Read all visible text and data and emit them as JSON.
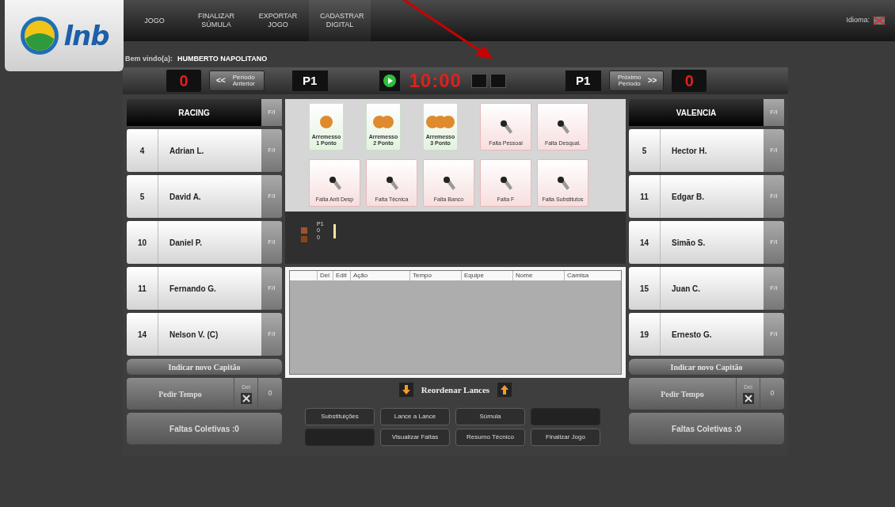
{
  "menu": [
    {
      "label": "JOGO",
      "selected": false
    },
    {
      "label": "FINALIZAR SÚMULA",
      "selected": false
    },
    {
      "label": "EXPORTAR JOGO",
      "selected": false
    },
    {
      "label": "CADASTRAR DIGITAL",
      "selected": true
    }
  ],
  "logo": {
    "text": "lnb"
  },
  "language": {
    "label": "Idioma:"
  },
  "welcome": {
    "label": "Bem vindo(a):",
    "user": "HUMBERTO NAPOLITANO"
  },
  "scoreboard": {
    "home_score": "0",
    "prev_button": {
      "arrow": "<<",
      "label": "Período Anterior"
    },
    "period_left": "P1",
    "clock": "10:00",
    "period_right": "P1",
    "next_button": {
      "arrow": ">>",
      "label": "Próximo Período"
    },
    "away_score": "0"
  },
  "teams": [
    {
      "name": "RACING",
      "tag": "F/I",
      "players": [
        {
          "number": "4",
          "name": "Adrian L.",
          "tag": "F/I"
        },
        {
          "number": "5",
          "name": "David A.",
          "tag": "F/I"
        },
        {
          "number": "10",
          "name": "Daniel P.",
          "tag": "F/I"
        },
        {
          "number": "11",
          "name": "Fernando G.",
          "tag": "F/I"
        },
        {
          "number": "14",
          "name": "Nelson V. (C)",
          "tag": "F/I"
        }
      ],
      "captain_button": "Indicar novo Capitão",
      "timeout_button": "Pedir Tempo",
      "delete_label": "Del",
      "timeouts": "0",
      "team_fouls": "Faltas Coletivas :0"
    },
    {
      "name": "VALENCIA",
      "tag": "F/I",
      "players": [
        {
          "number": "5",
          "name": "Hector H.",
          "tag": "F/I"
        },
        {
          "number": "11",
          "name": "Edgar B.",
          "tag": "F/I"
        },
        {
          "number": "14",
          "name": "Simão S.",
          "tag": "F/I"
        },
        {
          "number": "15",
          "name": "Juan C.",
          "tag": "F/I"
        },
        {
          "number": "19",
          "name": "Ernesto G.",
          "tag": "F/I"
        }
      ],
      "captain_button": "Indicar novo Capitão",
      "timeout_button": "Pedir Tempo",
      "delete_label": "Del",
      "timeouts": "0",
      "team_fouls": "Faltas Coletivas :0"
    }
  ],
  "actions": [
    {
      "kind": "single",
      "label": "Arremesso 1 Ponto"
    },
    {
      "kind": "double",
      "label": "Arremesso 2 Ponto"
    },
    {
      "kind": "triple",
      "label": "Arremesso 3 Ponto"
    },
    {
      "kind": "foul",
      "label": "Falta Pessoal"
    },
    {
      "kind": "foul",
      "label": "Falta Desqual."
    },
    {
      "kind": "foul",
      "label": "Falta Anti Desp"
    },
    {
      "kind": "foul",
      "label": "Falta Técnica"
    },
    {
      "kind": "foul",
      "label": "Falta Banco"
    },
    {
      "kind": "foul",
      "label": "Falta F"
    },
    {
      "kind": "foul",
      "label": "Falta Substitutos"
    }
  ],
  "period_stats": {
    "period": "P1",
    "home": "0",
    "away": "0",
    "markers": [
      {
        "color": "#a0522d"
      },
      {
        "color": "#8b4513"
      }
    ]
  },
  "log_table": {
    "columns": [
      "Del",
      "Edit",
      "Ação",
      "Tempo",
      "Equipe",
      "Nome",
      "Camisa"
    ]
  },
  "reorder": {
    "label": "Reordenar Lances"
  },
  "bottom_buttons": [
    {
      "label": "Substituições",
      "disabled": false
    },
    {
      "label": "Lance a Lance",
      "disabled": false
    },
    {
      "label": "Súmula",
      "disabled": false
    },
    {
      "disabled": true
    },
    {
      "disabled": true
    },
    {
      "label": "Visualizar Faltas",
      "disabled": false
    },
    {
      "label": "Resumo Técnico",
      "disabled": false
    },
    {
      "label": "Finalizar Jogo",
      "disabled": false
    }
  ]
}
